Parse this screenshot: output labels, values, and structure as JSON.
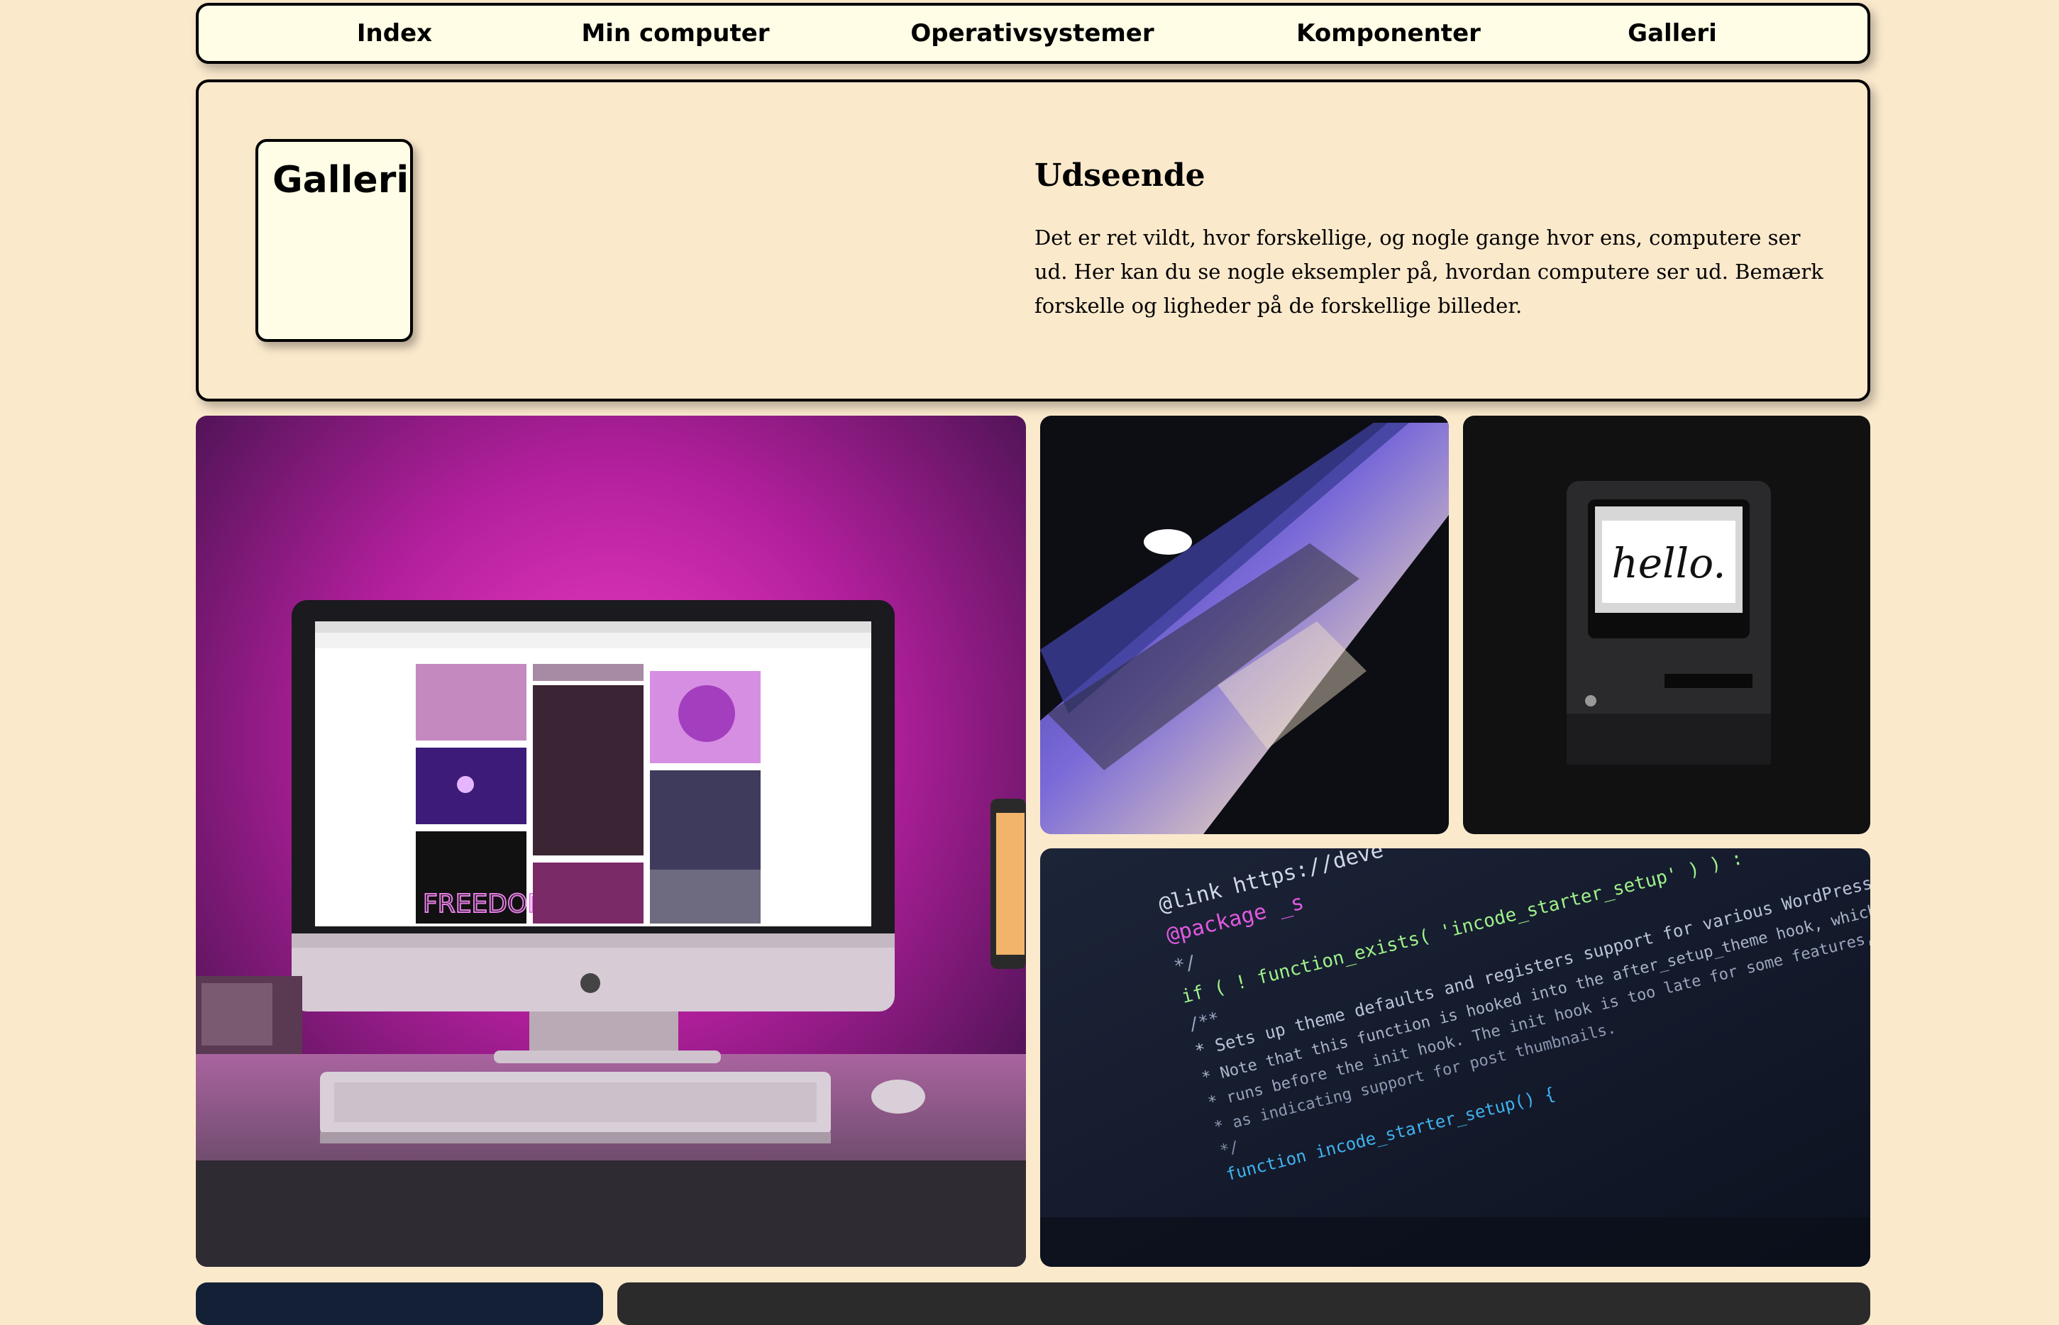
{
  "nav": {
    "items": [
      {
        "label": "Index"
      },
      {
        "label": "Min computer"
      },
      {
        "label": "Operativsystemer"
      },
      {
        "label": "Komponenter"
      },
      {
        "label": "Galleri"
      }
    ]
  },
  "header": {
    "title": "Galleri",
    "heading": "Udseende",
    "text": "Det er ret vildt, hvor forskellige, og nogle gange hvor ens, computere ser ud. Her kan du se nogle eksempler på, hvordan computere ser ud. Bemærk forskelle og ligheder på de forskellige billeder."
  },
  "gallery": {
    "photos": [
      {
        "subject": "imac-desk-photo",
        "screen_text": "FREEDOM"
      },
      {
        "subject": "macbook-photo"
      },
      {
        "subject": "classic-macintosh-photo",
        "screen_text": "hello."
      },
      {
        "subject": "code-screen-photo",
        "code_lines": [
          "@link https://deve",
          "@package _s",
          "*/",
          "if ( ! function_exists( 'incode_starter_setup' ) ) :",
          "/**",
          " * Sets up theme defaults and registers support for various WordPress",
          " * Note that this function is hooked into the after_setup_theme hook, which",
          " * runs before the init hook. The init hook is too late for some features,",
          " * as indicating support for post thumbnails.",
          " */",
          "function incode_starter_setup() {"
        ]
      },
      {
        "subject": "dark-tech-photo"
      },
      {
        "subject": "dark-grey-photo"
      }
    ]
  },
  "colors": {
    "page_bg": "#fbe9cc",
    "nav_bg": "#fffde6",
    "border": "#000000"
  }
}
